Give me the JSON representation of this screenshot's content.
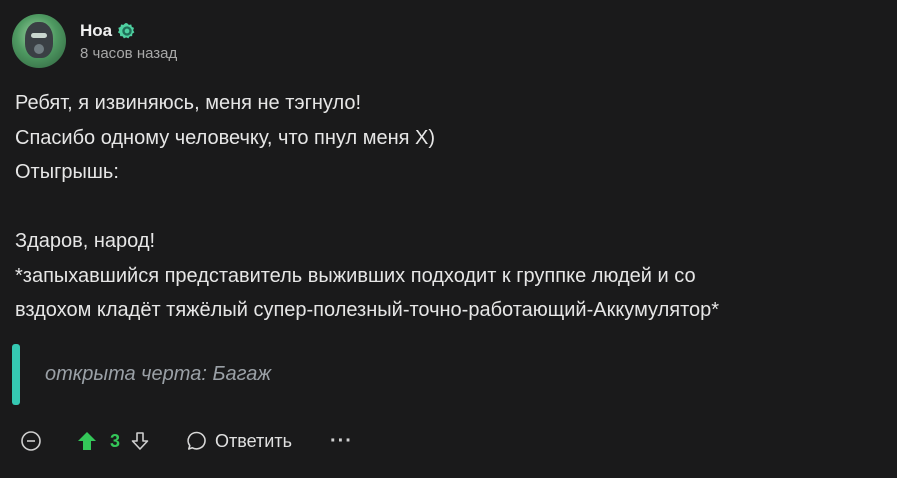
{
  "comment": {
    "author": {
      "username": "Hoa",
      "timestamp": "8 часов назад",
      "avatar_icon": "raccoon-avatar",
      "badge_icon": "verified-badge-icon",
      "badge_color": "#4fd1a1"
    },
    "body_lines": [
      "Ребят, я извиняюсь, меня не тэгнуло!",
      "Спасибо одному человечку, что пнул меня Х)",
      "Отыгрышь:",
      "",
      "Здаров, народ!",
      "*запыхавшийся представитель выживших подходит к группке людей и со",
      "вздохом кладёт тяжёлый супер-полезный-точно-работающий-Аккумулятор*"
    ],
    "quote": {
      "text": "открыта черта: Багаж",
      "accent_color": "#35c8b2"
    },
    "actions": {
      "collapse_icon": "collapse-minus-icon",
      "upvote_icon": "upvote-arrow-icon",
      "score": "3",
      "upvote_color": "#34c759",
      "downvote_icon": "downvote-arrow-icon",
      "reply_icon": "speech-bubble-icon",
      "reply_label": "Ответить",
      "more_label": "···"
    }
  }
}
